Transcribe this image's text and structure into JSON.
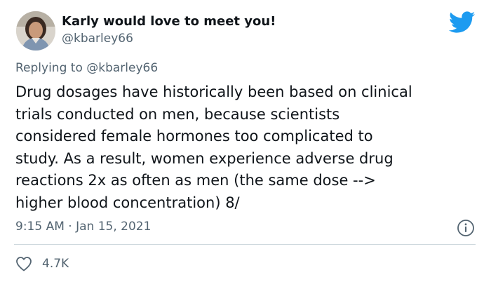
{
  "author": {
    "display_name": "Karly would love to meet you!",
    "handle": "@kbarley66"
  },
  "reply": {
    "prefix": "Replying to ",
    "mention": "@kbarley66"
  },
  "tweet": {
    "lines": [
      "Drug dosages have historically been based on clinical",
      "trials conducted on men, because scientists",
      "considered female hormones too complicated to",
      "study. As a result, women experience adverse drug",
      "reactions 2x as often as men (the same dose -->",
      "higher blood concentration) 8/"
    ],
    "timestamp": "9:15 AM · Jan 15, 2021",
    "like_count": "4.7K"
  },
  "icons": {
    "brand": "twitter-bird-icon",
    "info": "info-icon",
    "like": "heart-icon"
  },
  "colors": {
    "brand": "#1d9bf0",
    "secondary_text": "#536471",
    "primary_text": "#0f1419"
  }
}
